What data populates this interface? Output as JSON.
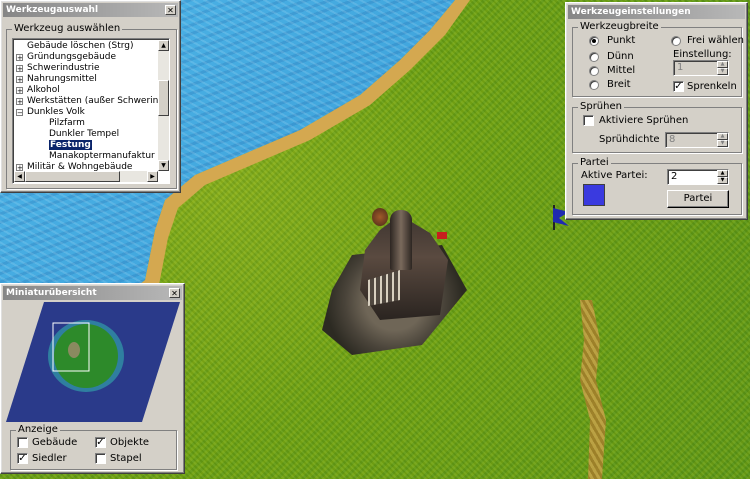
{
  "tool_window": {
    "title": "Werkzeugauswahl",
    "group_label": "Werkzeug auswählen",
    "tree_items": [
      {
        "label": "Gebäude löschen (Strg)",
        "level": 1,
        "expander": ""
      },
      {
        "label": "Gründungsgebäude",
        "level": 1,
        "expander": "+"
      },
      {
        "label": "Schwerindustrie",
        "level": 1,
        "expander": "+"
      },
      {
        "label": "Nahrungsmittel",
        "level": 1,
        "expander": "+"
      },
      {
        "label": "Alkohol",
        "level": 1,
        "expander": "+"
      },
      {
        "label": "Werkstätten (außer Schwerindust",
        "level": 1,
        "expander": "+"
      },
      {
        "label": "Dunkles Volk",
        "level": 1,
        "expander": "−"
      },
      {
        "label": "Pilzfarm",
        "level": 2,
        "expander": ""
      },
      {
        "label": "Dunkler Tempel",
        "level": 2,
        "expander": ""
      },
      {
        "label": "Festung",
        "level": 2,
        "expander": "",
        "selected": true
      },
      {
        "label": "Manakoptermanufaktur",
        "level": 2,
        "expander": ""
      },
      {
        "label": "Militär & Wohngebäude",
        "level": 1,
        "expander": "+"
      }
    ]
  },
  "minimap_window": {
    "title": "Miniaturübersicht",
    "display_group_label": "Anzeige",
    "options": {
      "buildings": {
        "label": "Gebäude",
        "checked": false
      },
      "objects": {
        "label": "Objekte",
        "checked": true
      },
      "settlers": {
        "label": "Siedler",
        "checked": true
      },
      "stacks": {
        "label": "Stapel",
        "checked": false
      }
    }
  },
  "settings_window": {
    "title": "Werkzeugeinstellungen",
    "width_group_label": "Werkzeugbreite",
    "width_options": [
      {
        "label": "Punkt",
        "selected": true
      },
      {
        "label": "Dünn",
        "selected": false
      },
      {
        "label": "Mittel",
        "selected": false
      },
      {
        "label": "Breit",
        "selected": false
      }
    ],
    "free_choice_label": "Frei wählen",
    "setting_label": "Einstellung:",
    "setting_value": "1",
    "sprinkle_label": "Sprenkeln",
    "sprinkle_checked": true,
    "spray_group_label": "Sprühen",
    "activate_spray_label": "Aktiviere Sprühen",
    "activate_spray_checked": false,
    "spray_density_label": "Sprühdichte",
    "spray_density_value": "8",
    "party_group_label": "Partei",
    "active_party_label": "Aktive Partei:",
    "active_party_value": "2",
    "party_color": "#3a3adf",
    "party_button_label": "Partei"
  },
  "colors": {
    "selection": "#0a246a",
    "titlebar": "#a0a0a0",
    "water": "#3aa0dc",
    "grass": "#6ea415"
  }
}
